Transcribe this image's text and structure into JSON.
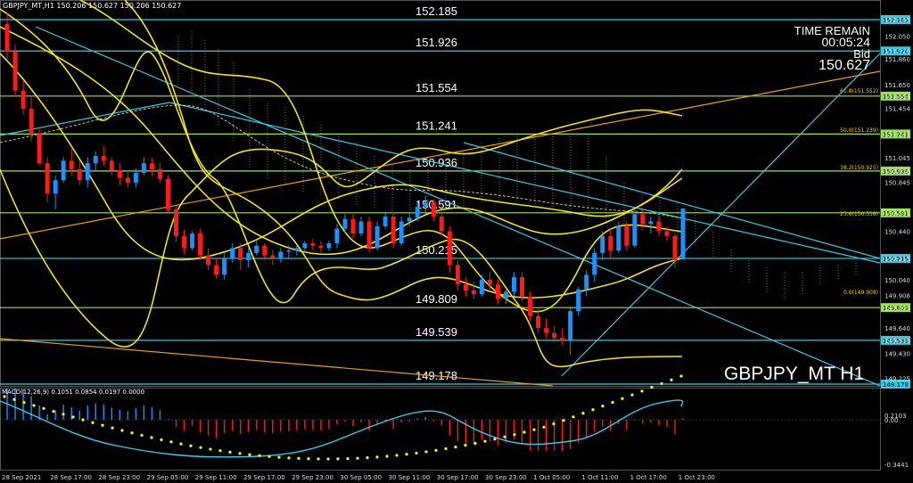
{
  "header": {
    "info": "GBPJPY_MT,H1  150.206 150.627 150.206 150.627"
  },
  "panel": {
    "time_remain_label": "TIME REMAIN",
    "time_remain_value": "00:05:24",
    "bid_label": "Bid",
    "bid_value": "150.627",
    "symbol": "GBPJPY_MT H1"
  },
  "macd": {
    "label": "MACD(12,26,9) 0.1051 0.0854 0.0197 0.0000",
    "axis": [
      "0.2103",
      "0.00",
      "-0.3441"
    ]
  },
  "colors": {
    "bull": "#1e90ff",
    "bear": "#ff1a1a",
    "level_cyan": "#3cc8e0",
    "level_green": "#9be05a",
    "band_yellow": "#f0e030",
    "trend_orange": "#e8a020",
    "signal_dots": "#ffff00"
  },
  "chart_data": {
    "type": "candlestick",
    "horizontal_levels": [
      {
        "price": 152.185,
        "label": "152.185",
        "color": "cyan"
      },
      {
        "price": 151.926,
        "label": "151.926",
        "color": "cyan"
      },
      {
        "price": 151.554,
        "label": "151.554",
        "color": "green"
      },
      {
        "price": 151.241,
        "label": "151.241",
        "color": "green"
      },
      {
        "price": 150.936,
        "label": "150.936",
        "color": "green"
      },
      {
        "price": 150.591,
        "label": "150.591",
        "color": "green"
      },
      {
        "price": 150.215,
        "label": "150.215",
        "color": "cyan"
      },
      {
        "price": 149.809,
        "label": "149.809",
        "color": "green"
      },
      {
        "price": 149.539,
        "label": "149.539",
        "color": "cyan"
      },
      {
        "price": 149.178,
        "label": "149.178",
        "color": "cyan"
      }
    ],
    "fibonacci": [
      "61.8(151.552)",
      "50.0(151.239)",
      "38.2(150.925)",
      "23.6(150.538)",
      "0.0(149.908)"
    ],
    "price_axis": [
      "152.185",
      "152.050",
      "151.926",
      "151.860",
      "151.650",
      "151.554",
      "151.454",
      "151.241",
      "151.045",
      "150.936",
      "150.845",
      "150.591",
      "150.440",
      "150.215",
      "150.040",
      "149.908",
      "149.809",
      "149.640",
      "149.539",
      "149.430",
      "149.225"
    ],
    "time_axis": [
      "28 Sep 2021",
      "28 Sep 17:00",
      "28 Sep 23:00",
      "29 Sep 05:00",
      "29 Sep 11:00",
      "29 Sep 17:00",
      "29 Sep 23:00",
      "30 Sep 05:00",
      "30 Sep 11:00",
      "30 Sep 17:00",
      "30 Sep 23:00",
      "1 Oct 05:00",
      "1 Oct 11:00",
      "1 Oct 17:00",
      "1 Oct 23:00"
    ],
    "price_range": [
      149.2,
      152.3
    ],
    "candles": [
      {
        "o": 152.15,
        "h": 152.25,
        "l": 151.86,
        "c": 151.92
      },
      {
        "o": 151.92,
        "h": 151.98,
        "l": 151.55,
        "c": 151.6
      },
      {
        "o": 151.6,
        "h": 151.68,
        "l": 151.4,
        "c": 151.45
      },
      {
        "o": 151.45,
        "h": 151.55,
        "l": 151.18,
        "c": 151.25
      },
      {
        "o": 151.25,
        "h": 151.3,
        "l": 150.98,
        "c": 151.0
      },
      {
        "o": 151.0,
        "h": 151.05,
        "l": 150.68,
        "c": 150.75
      },
      {
        "o": 150.75,
        "h": 150.9,
        "l": 150.62,
        "c": 150.86
      },
      {
        "o": 150.86,
        "h": 151.05,
        "l": 150.84,
        "c": 151.02
      },
      {
        "o": 151.02,
        "h": 151.12,
        "l": 150.9,
        "c": 150.95
      },
      {
        "o": 150.95,
        "h": 151.02,
        "l": 150.82,
        "c": 150.86
      },
      {
        "o": 150.86,
        "h": 151.05,
        "l": 150.8,
        "c": 151.0
      },
      {
        "o": 151.0,
        "h": 151.1,
        "l": 150.94,
        "c": 151.06
      },
      {
        "o": 151.06,
        "h": 151.14,
        "l": 150.98,
        "c": 151.02
      },
      {
        "o": 151.02,
        "h": 151.05,
        "l": 150.9,
        "c": 150.94
      },
      {
        "o": 150.94,
        "h": 151.0,
        "l": 150.82,
        "c": 150.88
      },
      {
        "o": 150.88,
        "h": 150.94,
        "l": 150.8,
        "c": 150.84
      },
      {
        "o": 150.84,
        "h": 150.96,
        "l": 150.8,
        "c": 150.92
      },
      {
        "o": 150.92,
        "h": 151.05,
        "l": 150.9,
        "c": 151.0
      },
      {
        "o": 151.0,
        "h": 151.04,
        "l": 150.9,
        "c": 150.95
      },
      {
        "o": 150.95,
        "h": 151.0,
        "l": 150.84,
        "c": 150.87
      },
      {
        "o": 150.87,
        "h": 150.9,
        "l": 150.58,
        "c": 150.62
      },
      {
        "o": 150.62,
        "h": 150.65,
        "l": 150.35,
        "c": 150.4
      },
      {
        "o": 150.4,
        "h": 150.45,
        "l": 150.25,
        "c": 150.3
      },
      {
        "o": 150.3,
        "h": 150.44,
        "l": 150.28,
        "c": 150.42
      },
      {
        "o": 150.42,
        "h": 150.46,
        "l": 150.2,
        "c": 150.24
      },
      {
        "o": 150.24,
        "h": 150.3,
        "l": 150.12,
        "c": 150.16
      },
      {
        "o": 150.16,
        "h": 150.22,
        "l": 150.05,
        "c": 150.08
      },
      {
        "o": 150.08,
        "h": 150.26,
        "l": 150.04,
        "c": 150.22
      },
      {
        "o": 150.22,
        "h": 150.34,
        "l": 150.18,
        "c": 150.3
      },
      {
        "o": 150.3,
        "h": 150.34,
        "l": 150.12,
        "c": 150.2
      },
      {
        "o": 150.2,
        "h": 150.3,
        "l": 150.14,
        "c": 150.26
      },
      {
        "o": 150.26,
        "h": 150.36,
        "l": 150.24,
        "c": 150.32
      },
      {
        "o": 150.32,
        "h": 150.34,
        "l": 150.2,
        "c": 150.24
      },
      {
        "o": 150.24,
        "h": 150.28,
        "l": 150.16,
        "c": 150.22
      },
      {
        "o": 150.22,
        "h": 150.3,
        "l": 150.18,
        "c": 150.27
      },
      {
        "o": 150.27,
        "h": 150.32,
        "l": 150.22,
        "c": 150.28
      },
      {
        "o": 150.28,
        "h": 150.32,
        "l": 150.24,
        "c": 150.3
      },
      {
        "o": 150.3,
        "h": 150.36,
        "l": 150.26,
        "c": 150.34
      },
      {
        "o": 150.34,
        "h": 150.38,
        "l": 150.28,
        "c": 150.32
      },
      {
        "o": 150.32,
        "h": 150.36,
        "l": 150.26,
        "c": 150.3
      },
      {
        "o": 150.3,
        "h": 150.36,
        "l": 150.28,
        "c": 150.34
      },
      {
        "o": 150.34,
        "h": 150.5,
        "l": 150.3,
        "c": 150.46
      },
      {
        "o": 150.46,
        "h": 150.58,
        "l": 150.42,
        "c": 150.54
      },
      {
        "o": 150.54,
        "h": 150.58,
        "l": 150.38,
        "c": 150.42
      },
      {
        "o": 150.42,
        "h": 150.56,
        "l": 150.4,
        "c": 150.52
      },
      {
        "o": 150.52,
        "h": 150.56,
        "l": 150.26,
        "c": 150.3
      },
      {
        "o": 150.3,
        "h": 150.52,
        "l": 150.28,
        "c": 150.48
      },
      {
        "o": 150.48,
        "h": 150.6,
        "l": 150.46,
        "c": 150.56
      },
      {
        "o": 150.56,
        "h": 150.6,
        "l": 150.3,
        "c": 150.34
      },
      {
        "o": 150.34,
        "h": 150.56,
        "l": 150.32,
        "c": 150.52
      },
      {
        "o": 150.52,
        "h": 150.6,
        "l": 150.48,
        "c": 150.55
      },
      {
        "o": 150.55,
        "h": 150.68,
        "l": 150.52,
        "c": 150.64
      },
      {
        "o": 150.64,
        "h": 150.73,
        "l": 150.58,
        "c": 150.68
      },
      {
        "o": 150.68,
        "h": 150.7,
        "l": 150.52,
        "c": 150.56
      },
      {
        "o": 150.56,
        "h": 150.6,
        "l": 150.4,
        "c": 150.44
      },
      {
        "o": 150.44,
        "h": 150.48,
        "l": 150.1,
        "c": 150.16
      },
      {
        "o": 150.16,
        "h": 150.2,
        "l": 149.95,
        "c": 150.0
      },
      {
        "o": 150.0,
        "h": 150.06,
        "l": 149.9,
        "c": 149.95
      },
      {
        "o": 149.95,
        "h": 150.02,
        "l": 149.88,
        "c": 149.92
      },
      {
        "o": 149.92,
        "h": 150.08,
        "l": 149.9,
        "c": 150.04
      },
      {
        "o": 150.04,
        "h": 150.1,
        "l": 149.96,
        "c": 150.0
      },
      {
        "o": 150.0,
        "h": 150.04,
        "l": 149.84,
        "c": 149.88
      },
      {
        "o": 149.88,
        "h": 149.96,
        "l": 149.84,
        "c": 149.94
      },
      {
        "o": 149.94,
        "h": 150.1,
        "l": 149.9,
        "c": 150.06
      },
      {
        "o": 150.06,
        "h": 150.1,
        "l": 149.86,
        "c": 149.9
      },
      {
        "o": 149.9,
        "h": 149.94,
        "l": 149.7,
        "c": 149.74
      },
      {
        "o": 149.74,
        "h": 149.8,
        "l": 149.6,
        "c": 149.64
      },
      {
        "o": 149.64,
        "h": 149.72,
        "l": 149.56,
        "c": 149.6
      },
      {
        "o": 149.6,
        "h": 149.66,
        "l": 149.52,
        "c": 149.56
      },
      {
        "o": 149.56,
        "h": 149.64,
        "l": 149.5,
        "c": 149.54
      },
      {
        "o": 149.54,
        "h": 149.82,
        "l": 149.42,
        "c": 149.78
      },
      {
        "o": 149.78,
        "h": 149.98,
        "l": 149.74,
        "c": 149.96
      },
      {
        "o": 149.96,
        "h": 150.12,
        "l": 149.9,
        "c": 150.08
      },
      {
        "o": 150.08,
        "h": 150.3,
        "l": 150.02,
        "c": 150.26
      },
      {
        "o": 150.26,
        "h": 150.44,
        "l": 150.2,
        "c": 150.4
      },
      {
        "o": 150.4,
        "h": 150.46,
        "l": 150.22,
        "c": 150.28
      },
      {
        "o": 150.28,
        "h": 150.52,
        "l": 150.26,
        "c": 150.48
      },
      {
        "o": 150.48,
        "h": 150.52,
        "l": 150.28,
        "c": 150.32
      },
      {
        "o": 150.32,
        "h": 150.62,
        "l": 150.3,
        "c": 150.58
      },
      {
        "o": 150.58,
        "h": 150.62,
        "l": 150.46,
        "c": 150.5
      },
      {
        "o": 150.5,
        "h": 150.56,
        "l": 150.42,
        "c": 150.52
      },
      {
        "o": 150.52,
        "h": 150.56,
        "l": 150.4,
        "c": 150.44
      },
      {
        "o": 150.44,
        "h": 150.48,
        "l": 150.36,
        "c": 150.4
      },
      {
        "o": 150.4,
        "h": 150.42,
        "l": 150.14,
        "c": 150.2
      },
      {
        "o": 150.206,
        "h": 150.627,
        "l": 150.206,
        "c": 150.627
      }
    ]
  }
}
